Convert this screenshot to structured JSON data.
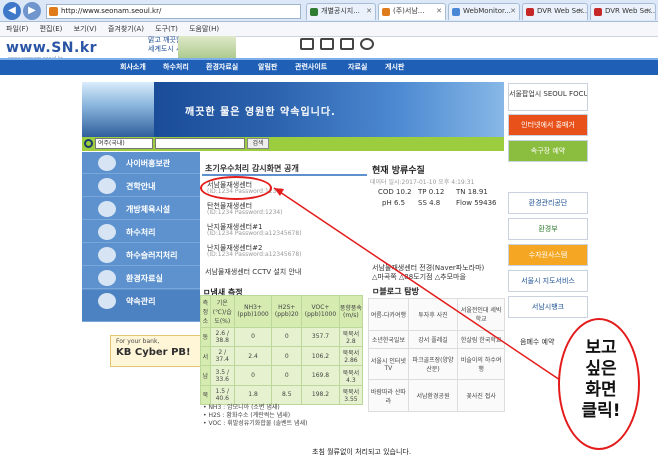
{
  "browser": {
    "address": "http://www.seonam.seoul.kr/",
    "tabs": [
      {
        "label": "개별공시지...",
        "color": "#2f7d32"
      },
      {
        "label": "(주)서남...",
        "color": "#e07b1c"
      },
      {
        "label": "WebMonitor...",
        "color": "#4a88d6"
      },
      {
        "label": "DVR Web Se...",
        "color": "#c62828"
      },
      {
        "label": "DVR Web Se...",
        "color": "#c62828"
      }
    ],
    "menu": [
      "파일(F)",
      "편집(E)",
      "보기(V)",
      "즐겨찾기(A)",
      "도구(T)",
      "도움말(H)"
    ]
  },
  "site": {
    "logo": "www.SN.kr",
    "logo_url": "www.seonam.seoul.kr",
    "slogan_line1": "맑고 깨끗한",
    "slogan_line2": "세계도시 서울!",
    "nav": [
      "회사소개",
      "하수처리",
      "환경자료실",
      "알림판",
      "관련사이트",
      "자료실",
      "게시판"
    ],
    "banner_text": "깨끗한 물은 영원한 약속입니다.",
    "search": {
      "select": "여주(국내)",
      "button": "검색"
    },
    "left_menu": [
      "사이버홍보관",
      "견학안내",
      "개방체육시설",
      "하수처리",
      "하수슬러지처리",
      "환경자료실",
      "약속관리"
    ],
    "kb": {
      "small": "For your bank,",
      "big": "KB Cyber PB!"
    }
  },
  "sewage": {
    "title": "초기우수처리 감시화면 공개",
    "items": [
      {
        "name": "서남물재생센터",
        "pw": "(ID:1234  Password:1234)"
      },
      {
        "name": "탄천물재생센터",
        "pw": "(ID:1234  Password:1234)"
      },
      {
        "name": "난지물재생센터#1",
        "pw": "(ID:1234  Password:a12345678)"
      },
      {
        "name": "난지물재생센터#2",
        "pw": "(ID:1234  Password:a12345678)"
      }
    ],
    "cctv": "서남물재생센터 CCTV 설치 안내"
  },
  "water": {
    "title": "현재 방류수질",
    "time": "데이터 일시:2017-01-10 오후 4:19:31",
    "rows": [
      [
        {
          "k": "COD",
          "v": "10.2"
        },
        {
          "k": "TP",
          "v": "0.12"
        },
        {
          "k": "TN",
          "v": "18.91"
        }
      ],
      [
        {
          "k": "pH",
          "v": "6.5"
        },
        {
          "k": "SS",
          "v": "4.8"
        },
        {
          "k": "Flow",
          "v": "59436"
        }
      ]
    ]
  },
  "air": {
    "title": "ㅁ냄새 측정",
    "headers": [
      "측정소",
      "기온(℃)/습도(%)",
      "NH3+(ppb)1000",
      "H2S+(ppb)20",
      "VOC+(ppb)1000",
      "풍향풍속(m/s)"
    ],
    "rows": [
      {
        "side": "동",
        "temp": "2.6 / 38.8",
        "nh3": "0",
        "h2s": "0",
        "voc": "357.7",
        "wind": "북북서 2.8"
      },
      {
        "side": "서",
        "temp": "2 / 37.4",
        "nh3": "2.4",
        "h2s": "0",
        "voc": "106.2",
        "wind": "북북서 2.86"
      },
      {
        "side": "남",
        "temp": "3.5 / 33.6",
        "nh3": "0",
        "h2s": "0",
        "voc": "169.8",
        "wind": "북북서 4.3"
      },
      {
        "side": "북",
        "temp": "1.5 / 40.6",
        "nh3": "1.8",
        "h2s": "8.5",
        "voc": "198.2",
        "wind": "북북서 3.55"
      }
    ],
    "notes": [
      "• NH3 : 암모니아 (소변 냄새)",
      "• H2S : 황화수소 (계란썩는 냄새)",
      "• VOC : 휘발성유기화합물 (솔벤트 냄새)"
    ]
  },
  "notice": {
    "line1": "서남물재생센터 전경(Naver파노라마)",
    "line2": "△마곡쪽  △88도기점  △추모마을",
    "blog_title": "ㅁ블로그 탐방",
    "blog": [
      [
        "여름-다카여행",
        "투자후 사진",
        "서울전인대 세빅학교"
      ],
      [
        "소년한국일보",
        "강서 플레길",
        "한살림 한국학교"
      ],
      [
        "서울시 인터넷TV",
        "파크골프장(양양산문)",
        "비슬이의 하수여행"
      ],
      [
        "바람따라 산따라",
        "서남환경공원",
        "꽃사진 접사"
      ]
    ]
  },
  "right": [
    "서울팝업시 SEOUL FOCUS",
    "인터넷에서 홍매거",
    "속구장 예약",
    "환경관리공단",
    "환경부",
    "수자원사스템",
    "서울시 지도서비스",
    "서남시뱅크"
  ],
  "right_cut": "음폐수 예약",
  "status": "초침 월류없이 처리되고 있습니다.",
  "annotation": "보고 싶은 화면 클릭!",
  "annotation_lines": [
    "보고",
    "싶은",
    "화면",
    "클릭!"
  ]
}
